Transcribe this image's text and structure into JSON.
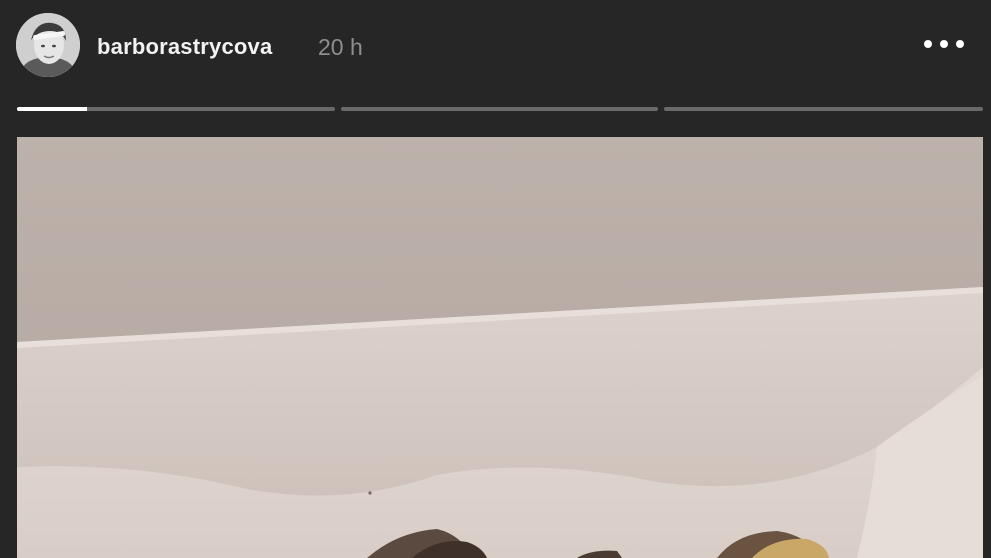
{
  "story": {
    "username": "barborastrycova",
    "time_ago": "20 h",
    "segments": [
      {
        "progress": 0.22
      },
      {
        "progress": 0
      },
      {
        "progress": 0
      }
    ]
  },
  "icons": {
    "more": "more-horizontal-icon"
  },
  "colors": {
    "background": "#262626",
    "username": "#f2f2f2",
    "timestamp": "#8e8e8e",
    "progress_track": "#6a6a6a",
    "progress_fill": "#ffffff"
  }
}
